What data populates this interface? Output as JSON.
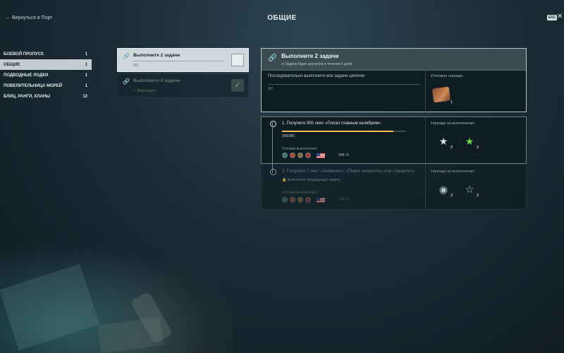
{
  "header": {
    "back_label": "← Вернуться в Порт",
    "title": "ОБЩИЕ",
    "esc_label": "ESC",
    "close_symbol": "✕"
  },
  "sidebar": {
    "items": [
      {
        "label": "БОЕВОЙ ПРОПУСК",
        "count": "1",
        "active": false
      },
      {
        "label": "ОБЩИЕ",
        "count": "1",
        "active": true
      },
      {
        "label": "ПОДВОДНЫЕ ЛОДКИ",
        "count": "1",
        "active": false
      },
      {
        "label": "ПОВЕЛИТЕЛЬНИЦА МОРЕЙ",
        "count": "1",
        "active": false
      },
      {
        "label": "БЛИЦ, РАНГИ, КЛАНЫ",
        "count": "12",
        "active": false
      }
    ]
  },
  "chains": [
    {
      "icon": "link-icon",
      "title": "Выполните 2 задачи",
      "sub": "0/2",
      "selected": true
    },
    {
      "icon": "link-icon",
      "title": "Выполните 4 задачи",
      "sub": "✓ Выполнено",
      "completed": true
    }
  ],
  "detail": {
    "title": "Выполните 2 задачи",
    "availability": "◷ Задача будет доступна в течение 6 дней",
    "description": "Последовательно выполните все задачи цепочки",
    "progress": "0/2",
    "reward_label": "Итоговая награда:",
    "reward_count": "1"
  },
  "tasks": [
    {
      "title": "1. Получите 300 лент «Попал главным калибром»",
      "progress_text": "269/300",
      "progress_fraction": 0.897,
      "conditions_label": "Условия выполнения:",
      "tier": "VIII–X",
      "reward_label": "Награда за выполнение:",
      "reward_a_count": "2",
      "reward_b_count": "2"
    },
    {
      "title": "2. Получите 7 лент «Захватил», «Помог захватить» или «Защитил»",
      "locked_text": "🔒 Выполните предыдущую задачу",
      "conditions_label": "Условия выполнения:",
      "tier": "VIII–X",
      "reward_label": "Награда за выполнение:",
      "reward_a_count": "2",
      "reward_b_count": "2"
    }
  ],
  "colors": {
    "accent_progress": "#f0c050",
    "completed_green": "#5e7a58",
    "star_green": "#6ad64a"
  }
}
